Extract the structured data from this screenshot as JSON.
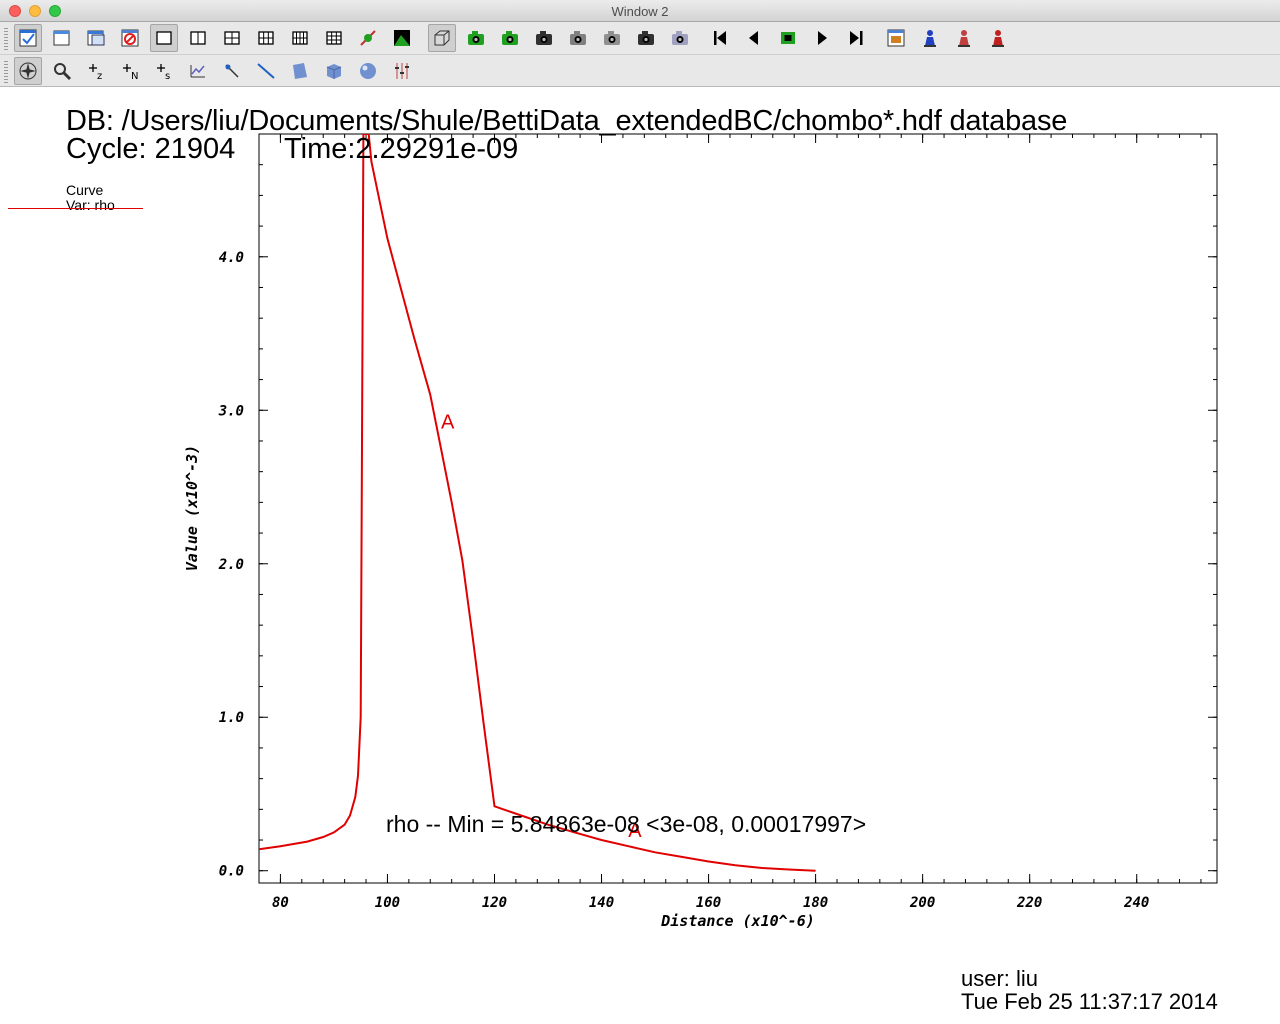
{
  "window": {
    "title": "Window 2"
  },
  "toolbar1": [
    {
      "name": "active-window-icon",
      "color": "#2b6fd6"
    },
    {
      "name": "new-window-icon",
      "color": "#4a8ae0"
    },
    {
      "name": "clone-window-icon",
      "color": "#3a78d6"
    },
    {
      "name": "delete-window-icon",
      "color": "#e02020"
    },
    {
      "name": "layout-1x1-icon",
      "color": "#000000"
    },
    {
      "name": "layout-1x2-icon",
      "color": "#000000"
    },
    {
      "name": "layout-2x2-icon",
      "color": "#000000"
    },
    {
      "name": "layout-2x3-icon",
      "color": "#000000"
    },
    {
      "name": "layout-2x4-icon",
      "color": "#000000"
    },
    {
      "name": "layout-3x3-icon",
      "color": "#000000"
    },
    {
      "name": "spin-icon",
      "color": "#20a020"
    },
    {
      "name": "invert-background-icon",
      "color": "#20a020"
    },
    {
      "name": "perspective-icon",
      "color": "#606060"
    },
    {
      "name": "save-view-icon",
      "color": "#20a020"
    },
    {
      "name": "choose-center-icon",
      "color": "#20a020"
    },
    {
      "name": "camera-icon",
      "color": "#303030"
    },
    {
      "name": "camera-lock-icon",
      "color": "#808080"
    },
    {
      "name": "camera-view-icon",
      "color": "#909090"
    },
    {
      "name": "lock-time-icon",
      "color": "#303030"
    },
    {
      "name": "lock-tools-icon",
      "color": "#a0a0c0"
    },
    {
      "name": "first-frame-icon",
      "color": "#000000"
    },
    {
      "name": "reverse-step-icon",
      "color": "#000000"
    },
    {
      "name": "stop-icon",
      "color": "#20a020"
    },
    {
      "name": "play-icon",
      "color": "#000000"
    },
    {
      "name": "forward-step-icon",
      "color": "#000000"
    },
    {
      "name": "plot-window-icon",
      "color": "#d08020"
    },
    {
      "name": "pick-icon",
      "color": "#2040c0"
    },
    {
      "name": "lineout-icon",
      "color": "#c04040"
    },
    {
      "name": "query-icon",
      "color": "#c02020"
    }
  ],
  "toolbar2": [
    {
      "name": "navigate-icon",
      "color": "#303030"
    },
    {
      "name": "zoom-icon",
      "color": "#303030"
    },
    {
      "name": "zone-pick-icon",
      "label": "z",
      "color": "#000000"
    },
    {
      "name": "node-pick-icon",
      "label": "N",
      "color": "#000000"
    },
    {
      "name": "spreadsheet-pick-icon",
      "label": "s",
      "color": "#000000"
    },
    {
      "name": "curve-pick-icon",
      "color": "#6060c0"
    },
    {
      "name": "point-tool-icon",
      "color": "#2060c0"
    },
    {
      "name": "line-tool-icon",
      "color": "#2060c0"
    },
    {
      "name": "plane-tool-icon",
      "color": "#7090d0"
    },
    {
      "name": "box-tool-icon",
      "color": "#7090d0"
    },
    {
      "name": "sphere-tool-icon",
      "color": "#7090d0"
    },
    {
      "name": "axis-restriction-icon",
      "color": "#c04040"
    }
  ],
  "annotations": {
    "db": "DB: /Users/liu/Documents/Shule/BettiData_extendedBC/chombo*.hdf database",
    "cycle": "Cycle: 21904",
    "time": "Time:2.29291e-09",
    "legend_title": "Curve",
    "legend_var": "Var: rho",
    "minmax": "rho -- Min = 5.84863e-08 <3e-08, 0.00017997>",
    "user": "user: liu",
    "date": "Tue Feb 25 11:37:17 2014"
  },
  "chart_data": {
    "type": "line",
    "xlabel": "Distance (x10^-6)",
    "ylabel": "Value (x10^-3)",
    "xlim": [
      76,
      255
    ],
    "ylim": [
      -0.08,
      4.8
    ],
    "xticks": [
      80,
      100,
      120,
      140,
      160,
      180,
      200,
      220,
      240
    ],
    "xtick_labels": [
      "80",
      "100",
      "120",
      "140",
      "160",
      "180",
      "200",
      "220",
      "240"
    ],
    "yticks": [
      0,
      1,
      2,
      3,
      4
    ],
    "ytick_labels": [
      "0.0",
      "1.0",
      "2.0",
      "3.0",
      "4.0"
    ],
    "grid": false,
    "line_color": "#e00000",
    "series": [
      {
        "marker": "A",
        "x": [
          76,
          80,
          85,
          88,
          90,
          92,
          93,
          94,
          94.5,
          95,
          95.2,
          95.5,
          96,
          96.5,
          97,
          100,
          105,
          108,
          110,
          112,
          114,
          116,
          118,
          120,
          125,
          130,
          135,
          140,
          145,
          150,
          155,
          160,
          165,
          170,
          175,
          180
        ],
        "y": [
          0.14,
          0.16,
          0.19,
          0.22,
          0.25,
          0.3,
          0.36,
          0.48,
          0.62,
          1.0,
          2.5,
          4.8,
          4.8,
          4.8,
          4.62,
          4.12,
          3.47,
          3.1,
          2.75,
          2.4,
          2.02,
          1.5,
          0.95,
          0.42,
          0.36,
          0.3,
          0.25,
          0.2,
          0.16,
          0.12,
          0.09,
          0.06,
          0.035,
          0.018,
          0.008,
          0.0
        ]
      }
    ],
    "curve_labels": [
      {
        "text": "A",
        "x": 110,
        "y": 2.88
      },
      {
        "text": "A",
        "x": 145,
        "y": 0.22
      }
    ]
  }
}
